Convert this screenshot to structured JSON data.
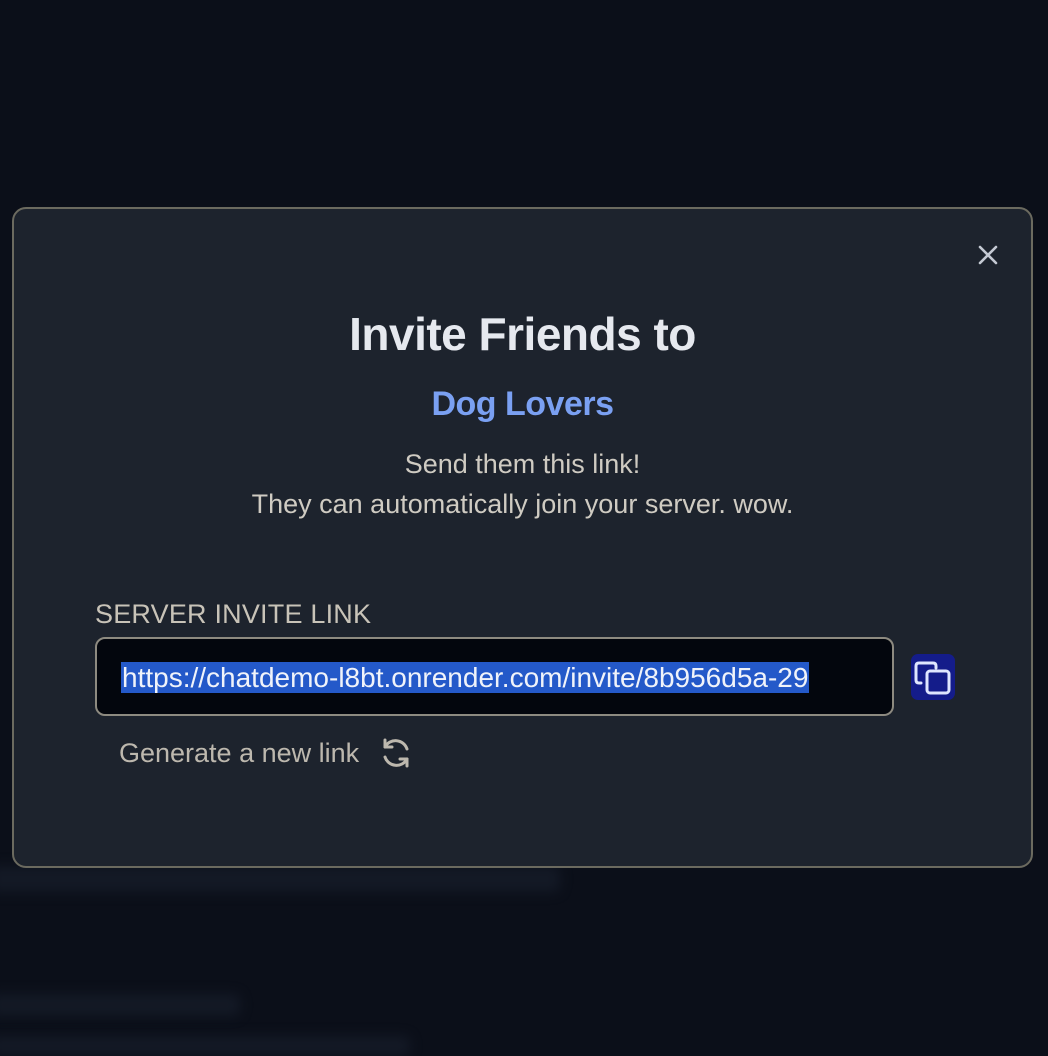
{
  "modal": {
    "title": "Invite Friends to",
    "server_name": "Dog Lovers",
    "subtitle_line1": "Send them this link!",
    "subtitle_line2": "They can automatically join your server. wow.",
    "field_label": "SERVER INVITE LINK",
    "invite_link_visible": "https://chatdemo-l8bt.onrender.com/invite/8b956d5a-29",
    "regenerate_label": "Generate a new link",
    "icons": {
      "close": "close-icon",
      "copy": "copy-icon",
      "refresh": "refresh-icon"
    }
  },
  "colors": {
    "background": "#0b0f19",
    "modal": "#1d232d",
    "accent_text": "#7aa0f2",
    "selection": "#2459c9",
    "copy_button": "#141c8a"
  }
}
